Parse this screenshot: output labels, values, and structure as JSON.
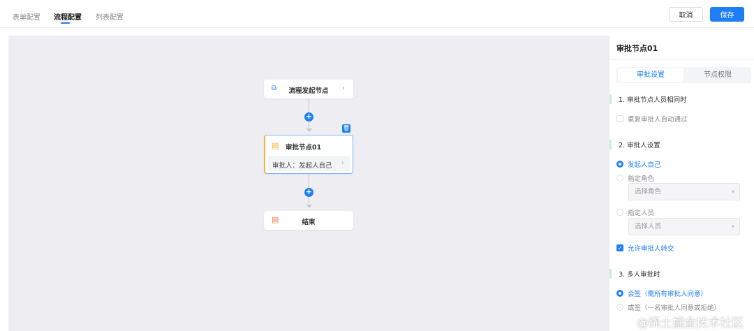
{
  "tabs": [
    {
      "label": "表单配置"
    },
    {
      "label": "流程配置",
      "active": true
    },
    {
      "label": "列表配置"
    }
  ],
  "actions": {
    "cancel": "取消",
    "save": "保存"
  },
  "flow": {
    "start": {
      "label": "流程发起节点"
    },
    "approval": {
      "title": "审批节点01",
      "approver": "审批人：发起人自己"
    },
    "end": {
      "label": "结束"
    }
  },
  "panel": {
    "title": "审批节点01",
    "tabs": [
      "审批设置",
      "节点权限"
    ],
    "section1": {
      "title": "1. 审批节点人员相同时",
      "auto_pass": "重复审批人自动通过",
      "auto_pass_checked": false
    },
    "section2": {
      "title": "2. 审批人设置",
      "opt_self": "发起人自己",
      "opt_role": "指定角色",
      "role_placeholder": "选择角色",
      "opt_user": "指定人员",
      "user_placeholder": "选择人员",
      "allow_transfer": "允许审批人转交",
      "allow_transfer_checked": true
    },
    "section3": {
      "title": "3. 多人审批时",
      "opt_all": "会签（需所有审批人同意）",
      "opt_any": "或签（一名审批人同意或拒绝）"
    }
  },
  "watermark": "@稀土掘金技术社区",
  "colors": {
    "accent": "#1e7ff5"
  }
}
